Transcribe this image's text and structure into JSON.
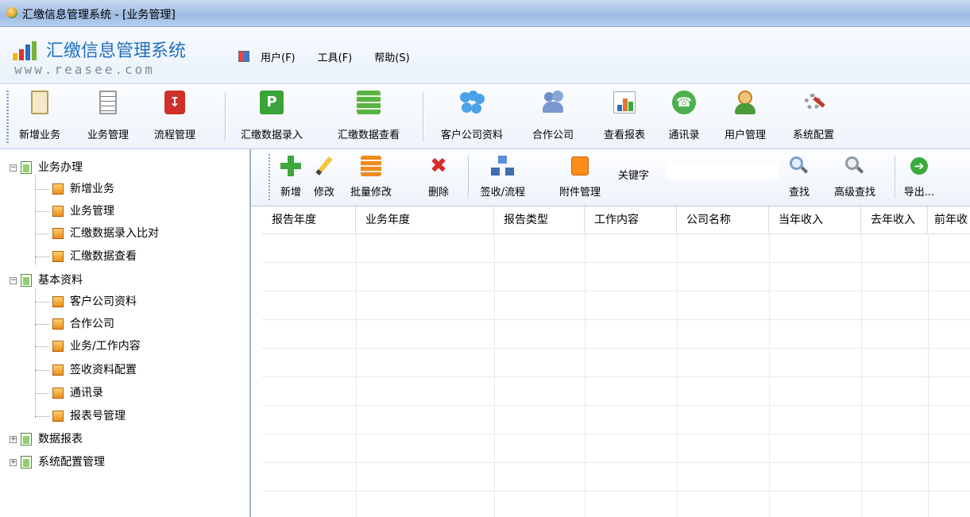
{
  "window": {
    "title": "汇缴信息管理系统 - [业务管理]"
  },
  "logo": {
    "name": "汇缴信息管理系统",
    "url": "www.reasee.com"
  },
  "menu": {
    "items": [
      "用户(F)",
      "工具(F)",
      "帮助(S)"
    ]
  },
  "toolbar": {
    "items": [
      "新增业务",
      "业务管理",
      "流程管理",
      "汇缴数据录入",
      "汇缴数据查看",
      "客户公司资料",
      "合作公司",
      "查看报表",
      "通讯录",
      "用户管理",
      "系统配置"
    ]
  },
  "tree": {
    "group1": {
      "label": "业务办理",
      "items": [
        "新增业务",
        "业务管理",
        "汇缴数据录入比对",
        "汇缴数据查看"
      ]
    },
    "group2": {
      "label": "基本资料",
      "items": [
        "客户公司资料",
        "合作公司",
        "业务/工作内容",
        "签收资料配置",
        "通讯录",
        "报表号管理"
      ]
    },
    "group3": {
      "label": "数据报表"
    },
    "group4": {
      "label": "系统配置管理"
    }
  },
  "subtoolbar": {
    "new": "新增",
    "edit": "修改",
    "batch_edit": "批量修改",
    "delete": "删除",
    "sign_flow": "签收/流程",
    "attachments": "附件管理",
    "keyword_label": "关键字",
    "keyword_value": "",
    "search": "查找",
    "advanced_search": "高级查找",
    "export": "导出..."
  },
  "grid": {
    "columns": [
      "报告年度",
      "业务年度",
      "报告类型",
      "工作内容",
      "公司名称",
      "当年收入",
      "去年收入",
      "前年收"
    ]
  },
  "colors": {
    "accent": "#1f6fbf",
    "titlebar": "#a9c3e6",
    "tree_folder": "#4a8f2f"
  }
}
